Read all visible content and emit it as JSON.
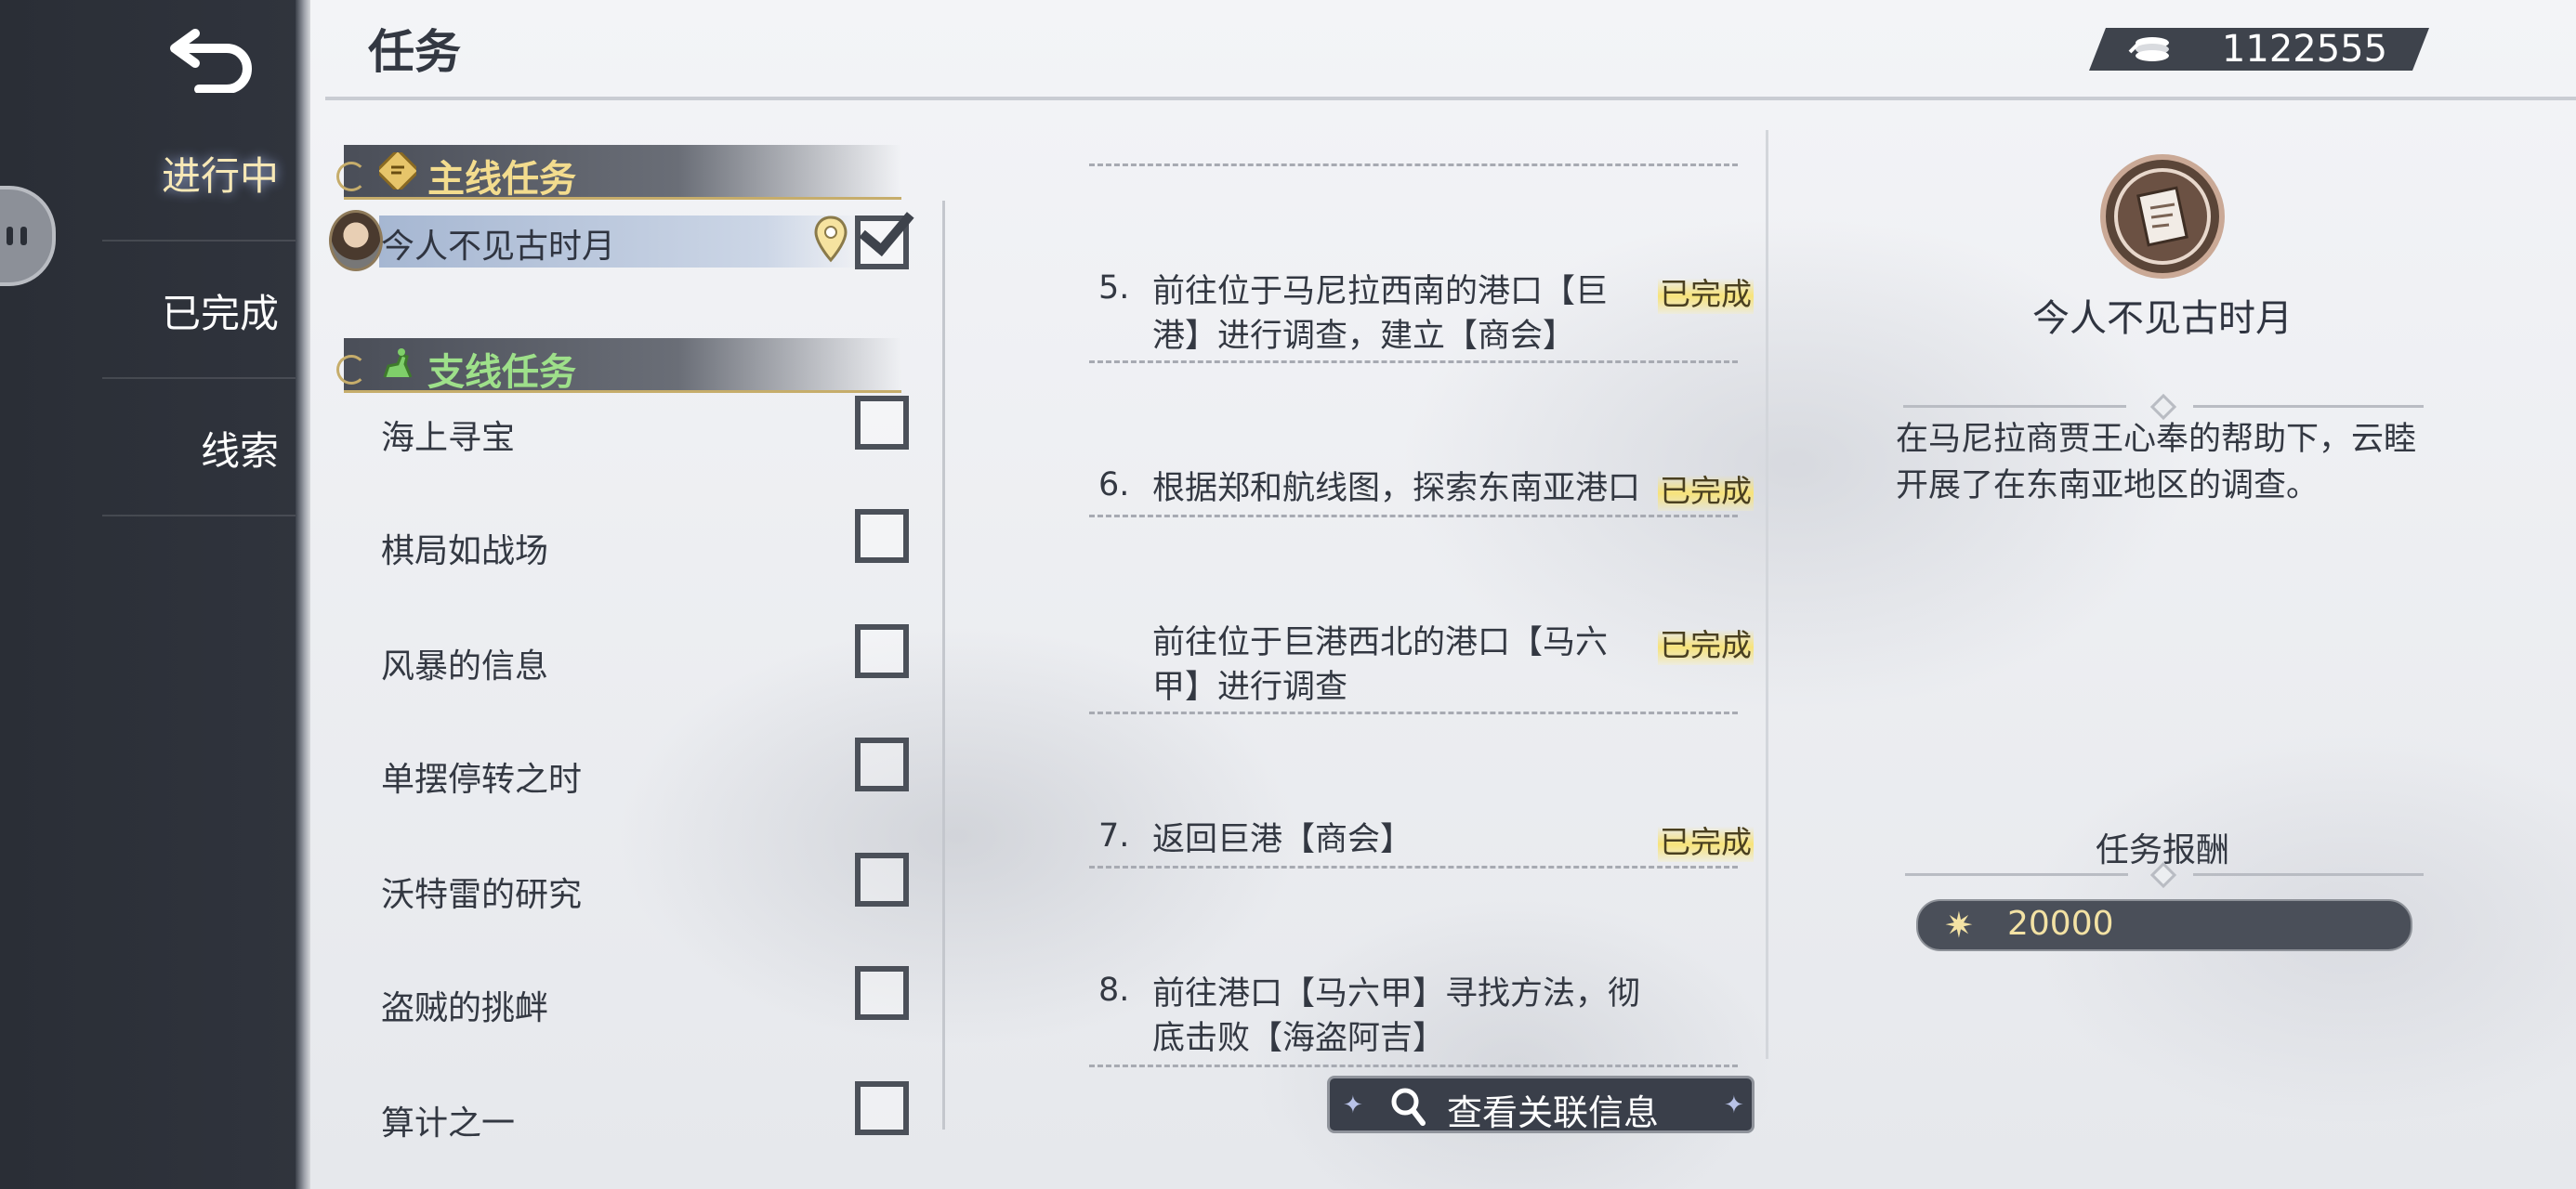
{
  "header": {
    "title": "任务",
    "coins": "1122555"
  },
  "nav": {
    "tabs": [
      "进行中",
      "已完成",
      "线索"
    ]
  },
  "quest_list": {
    "main_section": "主线任务",
    "main_quest": "今人不见古时月",
    "side_section": "支线任务",
    "side_quests": [
      "海上寻宝",
      "棋局如战场",
      "风暴的信息",
      "单摆停转之时",
      "沃特雷的研究",
      "盗贼的挑衅",
      "算计之一"
    ]
  },
  "steps": [
    {
      "num": "5.",
      "text": "前往位于马尼拉西南的港口【巨港】进行调查，建立【商会】",
      "status": "已完成"
    },
    {
      "num": "6.",
      "text": "根据郑和航线图，探索东南亚港口",
      "status": "已完成"
    },
    {
      "num": "",
      "text": "前往位于巨港西北的港口【马六甲】进行调查",
      "status": "已完成"
    },
    {
      "num": "7.",
      "text": "返回巨港【商会】",
      "status": "已完成"
    },
    {
      "num": "8.",
      "text": "前往港口【马六甲】寻找方法，彻底击败【海盗阿吉】",
      "status": ""
    }
  ],
  "related_button": "查看关联信息",
  "detail": {
    "title": "今人不见古时月",
    "description": "在马尼拉商贾王心奉的帮助下，云睦开展了在东南亚地区的调查。",
    "reward_title": "任务报酬",
    "reward_value": "20000"
  }
}
